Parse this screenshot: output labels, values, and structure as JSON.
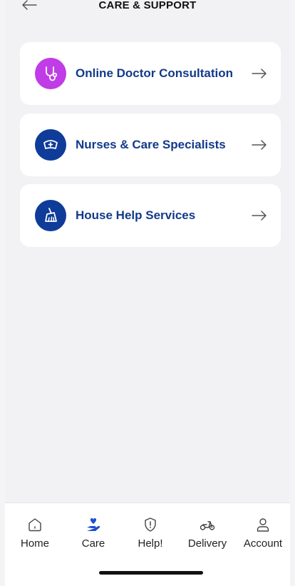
{
  "header": {
    "title": "CARE & SUPPORT"
  },
  "services": [
    {
      "label": "Online Doctor Consultation",
      "icon": "stethoscope-icon",
      "color": "#c03ce6"
    },
    {
      "label": "Nurses & Care Specialists",
      "icon": "nurse-cap-icon",
      "color": "#0f3c99"
    },
    {
      "label": "House Help Services",
      "icon": "cleaning-broom-icon",
      "color": "#0f3c99"
    }
  ],
  "nav": {
    "items": [
      {
        "label": "Home",
        "icon": "home-icon"
      },
      {
        "label": "Care",
        "icon": "care-hand-heart-icon",
        "active": true
      },
      {
        "label": "Help!",
        "icon": "shield-alert-icon"
      },
      {
        "label": "Delivery",
        "icon": "scooter-icon"
      },
      {
        "label": "Account",
        "icon": "user-icon"
      }
    ]
  },
  "colors": {
    "accent": "#123a8a",
    "active_nav": "#1c4fd0",
    "purple": "#c03ce6"
  }
}
